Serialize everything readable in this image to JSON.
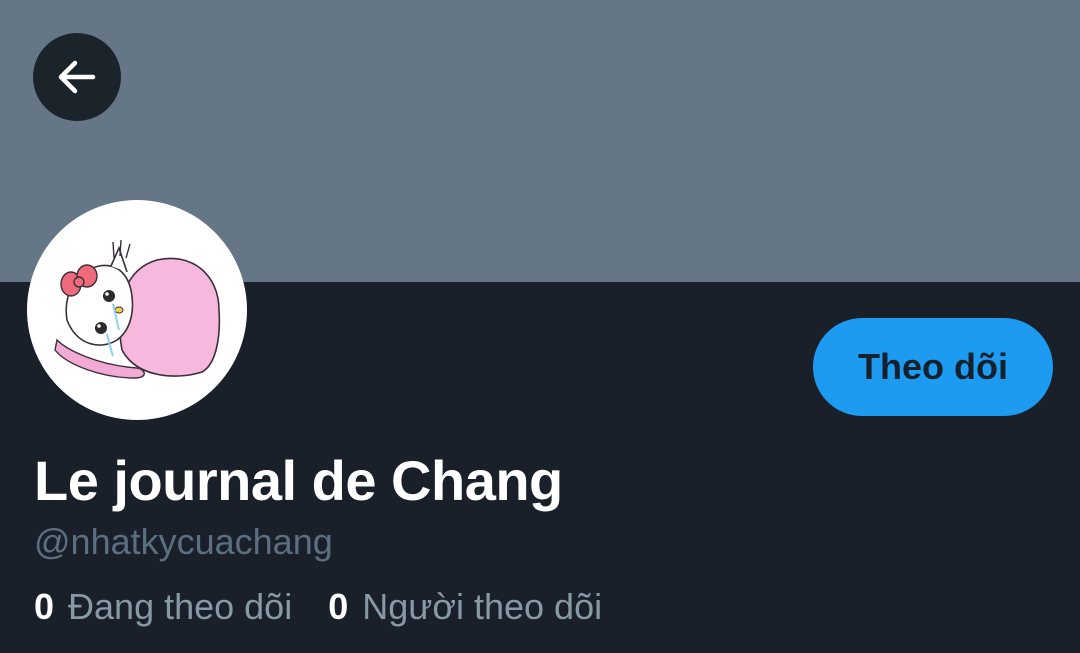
{
  "header": {
    "back_icon": "arrow-left-icon"
  },
  "profile": {
    "display_name": "Le journal de Chang",
    "handle": "@nhatkycuachang",
    "follow_button_label": "Theo dõi",
    "avatar_icon": "hello-kitty-avatar",
    "stats": [
      {
        "count": "0",
        "label": "Đang theo dõi"
      },
      {
        "count": "0",
        "label": "Người theo dõi"
      }
    ]
  },
  "colors": {
    "banner": "#657786",
    "background": "#192029",
    "accent": "#1d9bf0"
  }
}
